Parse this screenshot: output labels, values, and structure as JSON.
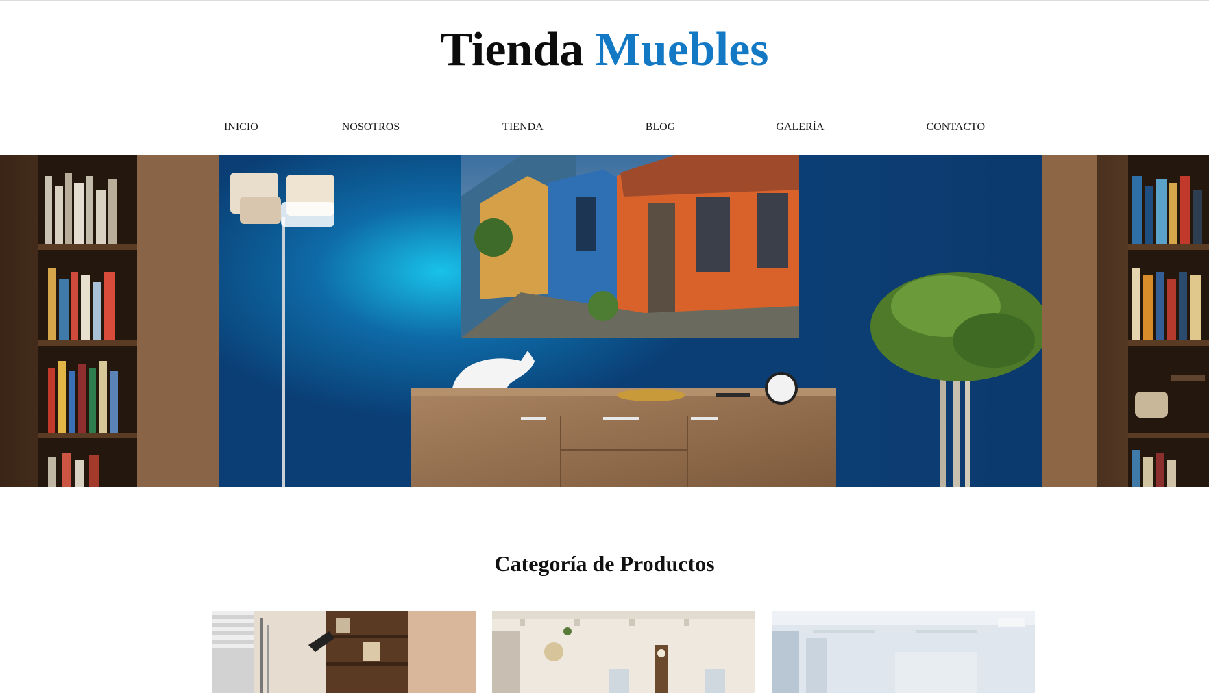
{
  "brand": {
    "word1": "Tienda",
    "word2": "Muebles",
    "accent_color": "#1379c5"
  },
  "nav": {
    "items": [
      {
        "label": "INICIO"
      },
      {
        "label": "NOSOTROS"
      },
      {
        "label": "TIENDA"
      },
      {
        "label": "BLOG"
      },
      {
        "label": "GALERÍA"
      },
      {
        "label": "CONTACTO"
      }
    ]
  },
  "hero": {
    "image": "living-room-blue-wall-banner"
  },
  "categories": {
    "title": "Categoría de Productos",
    "cards": [
      {
        "image": "study-room-photo"
      },
      {
        "image": "dining-room-photo"
      },
      {
        "image": "office-room-photo"
      }
    ]
  }
}
